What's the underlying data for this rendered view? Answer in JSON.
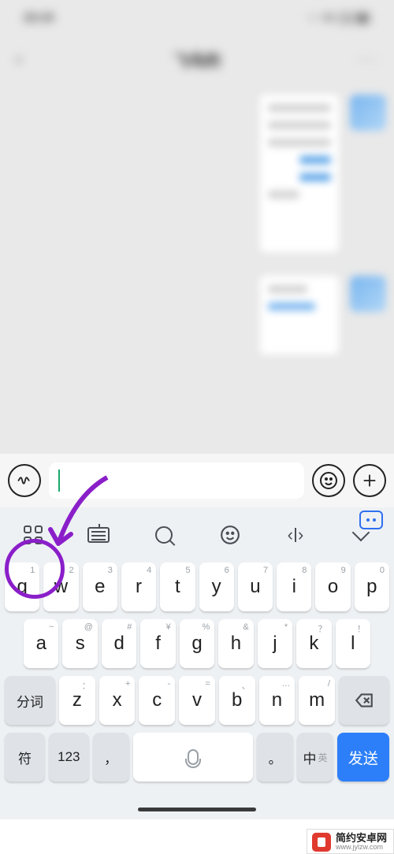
{
  "status": {
    "time": "23:15",
    "right": "⋯ ᯤ ▢▢◧"
  },
  "header": {
    "back": "‹",
    "title": "飞鸟的",
    "more": "···"
  },
  "inputbar": {
    "voice_label": "语音",
    "emoji_label": "表情",
    "plus_label": "更多"
  },
  "toolbar": {
    "apps": "应用",
    "keyboard": "键盘",
    "search": "搜索",
    "emoji": "表情",
    "cursor": "光标",
    "collapse": "收起"
  },
  "keys": {
    "row1": [
      {
        "m": "q",
        "s": "1"
      },
      {
        "m": "w",
        "s": "2"
      },
      {
        "m": "e",
        "s": "3"
      },
      {
        "m": "r",
        "s": "4"
      },
      {
        "m": "t",
        "s": "5"
      },
      {
        "m": "y",
        "s": "6"
      },
      {
        "m": "u",
        "s": "7"
      },
      {
        "m": "i",
        "s": "8"
      },
      {
        "m": "o",
        "s": "9"
      },
      {
        "m": "p",
        "s": "0"
      }
    ],
    "row2": [
      {
        "m": "a",
        "s": "~"
      },
      {
        "m": "s",
        "s": "@"
      },
      {
        "m": "d",
        "s": "#"
      },
      {
        "m": "f",
        "s": "¥"
      },
      {
        "m": "g",
        "s": "%"
      },
      {
        "m": "h",
        "s": "&"
      },
      {
        "m": "j",
        "s": "*"
      },
      {
        "m": "k",
        "s": "？"
      },
      {
        "m": "l",
        "s": "！"
      }
    ],
    "row3": [
      {
        "m": "z",
        "s": "："
      },
      {
        "m": "x",
        "s": "+"
      },
      {
        "m": "c",
        "s": "-"
      },
      {
        "m": "v",
        "s": "="
      },
      {
        "m": "b",
        "s": "、"
      },
      {
        "m": "n",
        "s": "…"
      },
      {
        "m": "m",
        "s": "/"
      }
    ],
    "fenci": "分词",
    "symbol": "符",
    "num": "123",
    "comma": "，",
    "period": "。",
    "lang_main": "中",
    "lang_sub": "英",
    "send": "发送"
  },
  "watermark": {
    "name": "简约安卓网",
    "url": "www.jylzw.com"
  }
}
